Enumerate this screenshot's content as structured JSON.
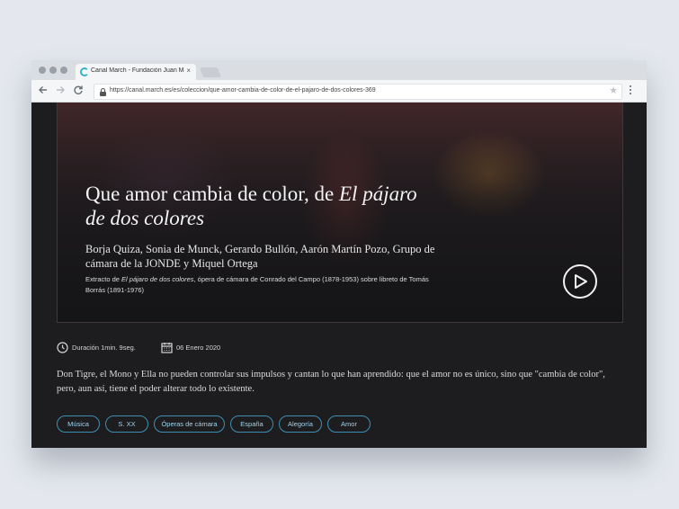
{
  "browser": {
    "tab_title": "Canal March - Fundación Juan Mar",
    "tab_close": "×",
    "url": "https://canal.march.es/es/coleccion/que-amor-cambia-de-color-de-el-pajaro-de-dos-colores-369",
    "icons": [
      "back-icon",
      "forward-icon",
      "reload-icon",
      "lock-icon",
      "star-icon",
      "menu-icon"
    ]
  },
  "hero": {
    "title_part1": "Que amor cambia de color, de ",
    "title_italic": "El pájaro de dos colores",
    "subtitle": "Borja Quiza, Sonia de Munck, Gerardo Bullón, Aarón Martín Pozo, Grupo de cámara de la JONDE y Miquel Ortega",
    "desc_prefix": "Extracto de ",
    "desc_italic": "El pájaro de dos colores",
    "desc_suffix": ", ópera de cámara de Conrado del Campo (1878-1953) sobre libreto de Tomás Borrás (1891-1976)"
  },
  "meta": {
    "duration": "Duración 1min. 9seg.",
    "date": "06 Enero 2020"
  },
  "description": "Don Tigre, el Mono y Ella no pueden controlar sus impulsos y cantan lo que han aprendido: que el amor no es único, sino que \"cambia de color\", pero, aun así, tiene el poder alterar todo lo existente.",
  "tags": [
    "Música",
    "S. XX",
    "Óperas de cámara",
    "España",
    "Alegoría",
    "Amor"
  ],
  "colors": {
    "background": "#e4e8ee",
    "page": "#1d1d20",
    "tag_border": "#3f8fb3",
    "tag_text": "#9fd3ea",
    "favicon": "#37b3c9"
  }
}
